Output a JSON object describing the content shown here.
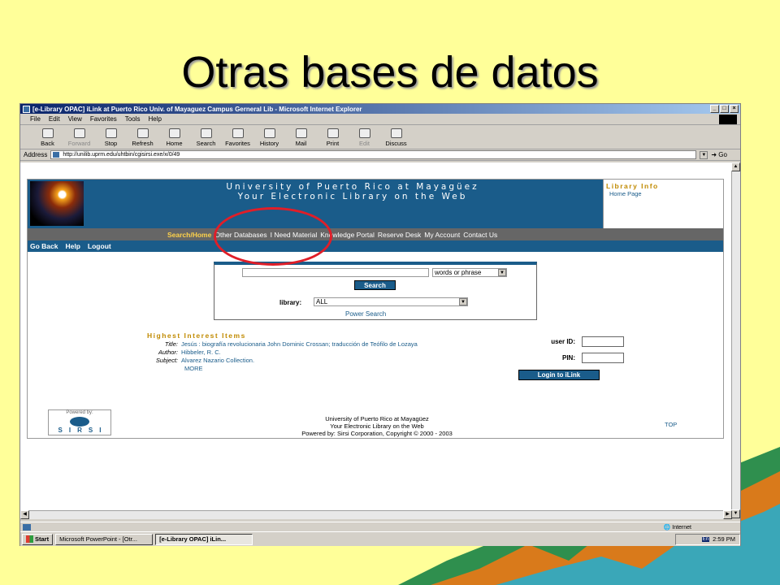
{
  "slide": {
    "title": "Otras bases de datos"
  },
  "browser": {
    "window_title": "[e-Library OPAC] iLink at Puerto Rico Univ. of Mayaguez Campus Gerneral Lib - Microsoft Internet Explorer",
    "menu": [
      "File",
      "Edit",
      "View",
      "Favorites",
      "Tools",
      "Help"
    ],
    "toolbar": [
      {
        "label": "Back",
        "icon": "back-arrow-icon"
      },
      {
        "label": "Forward",
        "icon": "forward-arrow-icon",
        "disabled": true
      },
      {
        "label": "Stop",
        "icon": "stop-icon"
      },
      {
        "label": "Refresh",
        "icon": "refresh-icon"
      },
      {
        "label": "Home",
        "icon": "home-icon"
      },
      {
        "label": "Search",
        "icon": "search-icon"
      },
      {
        "label": "Favorites",
        "icon": "favorites-icon"
      },
      {
        "label": "History",
        "icon": "history-icon"
      },
      {
        "label": "Mail",
        "icon": "mail-icon"
      },
      {
        "label": "Print",
        "icon": "print-icon"
      },
      {
        "label": "Edit",
        "icon": "edit-icon",
        "disabled": true
      },
      {
        "label": "Discuss",
        "icon": "discuss-icon"
      }
    ],
    "address_label": "Address",
    "address_url": "http://unilib.uprm.edu/uhtbin/cgisirsi.exe/x/0/49",
    "go_label": "Go",
    "status_zone": "Internet"
  },
  "page": {
    "banner_line1": "University of Puerto Rico at Mayagüez",
    "banner_line2": "Your Electronic Library on the Web",
    "library_info_heading": "Library Info",
    "library_info_link": "Home Page",
    "nav": [
      "Search/Home",
      "Other Databases",
      "I Need Material",
      "Knowledge Portal",
      "Reserve Desk",
      "My Account",
      "Contact Us"
    ],
    "subnav": [
      "Go Back",
      "Help",
      "Logout"
    ],
    "search": {
      "mode": "words or phrase",
      "button": "Search",
      "library_label": "library:",
      "library_value": "ALL",
      "power_search": "Power Search"
    },
    "highest_interest": {
      "heading": "Highest Interest Items",
      "rows": [
        {
          "key": "Title:",
          "value": "Jesús : biografía revolucionaria John Dominic Crossan; traducción de Teófilo de Lozaya"
        },
        {
          "key": "Author:",
          "value": "Hibbeler, R. C."
        },
        {
          "key": "Subject:",
          "value": "Alvarez Nazario Collection."
        }
      ],
      "more": "MORE"
    },
    "login": {
      "user_id_label": "user ID:",
      "pin_label": "PIN:",
      "button": "Login to iLink"
    },
    "powered_by": "Powered by:",
    "sirsi_logo": "SIRSI",
    "footer": [
      "University of Puerto Rico at Mayagüez",
      "Your Electronic Library on the Web",
      "Powered by: Sirsi Corporation, Copyright © 2000 - 2003"
    ],
    "top_link": "TOP"
  },
  "taskbar": {
    "start": "Start",
    "tasks": [
      "Microsoft PowerPoint - [Otr...",
      "[e-Library OPAC] iLin..."
    ],
    "lang": "En",
    "clock": "2:59 PM"
  },
  "colors": {
    "slide_bg": "#ffff99",
    "banner_blue": "#1a5c8a",
    "highlight_circle": "#e01e28",
    "accent_gold": "#c08a00"
  }
}
